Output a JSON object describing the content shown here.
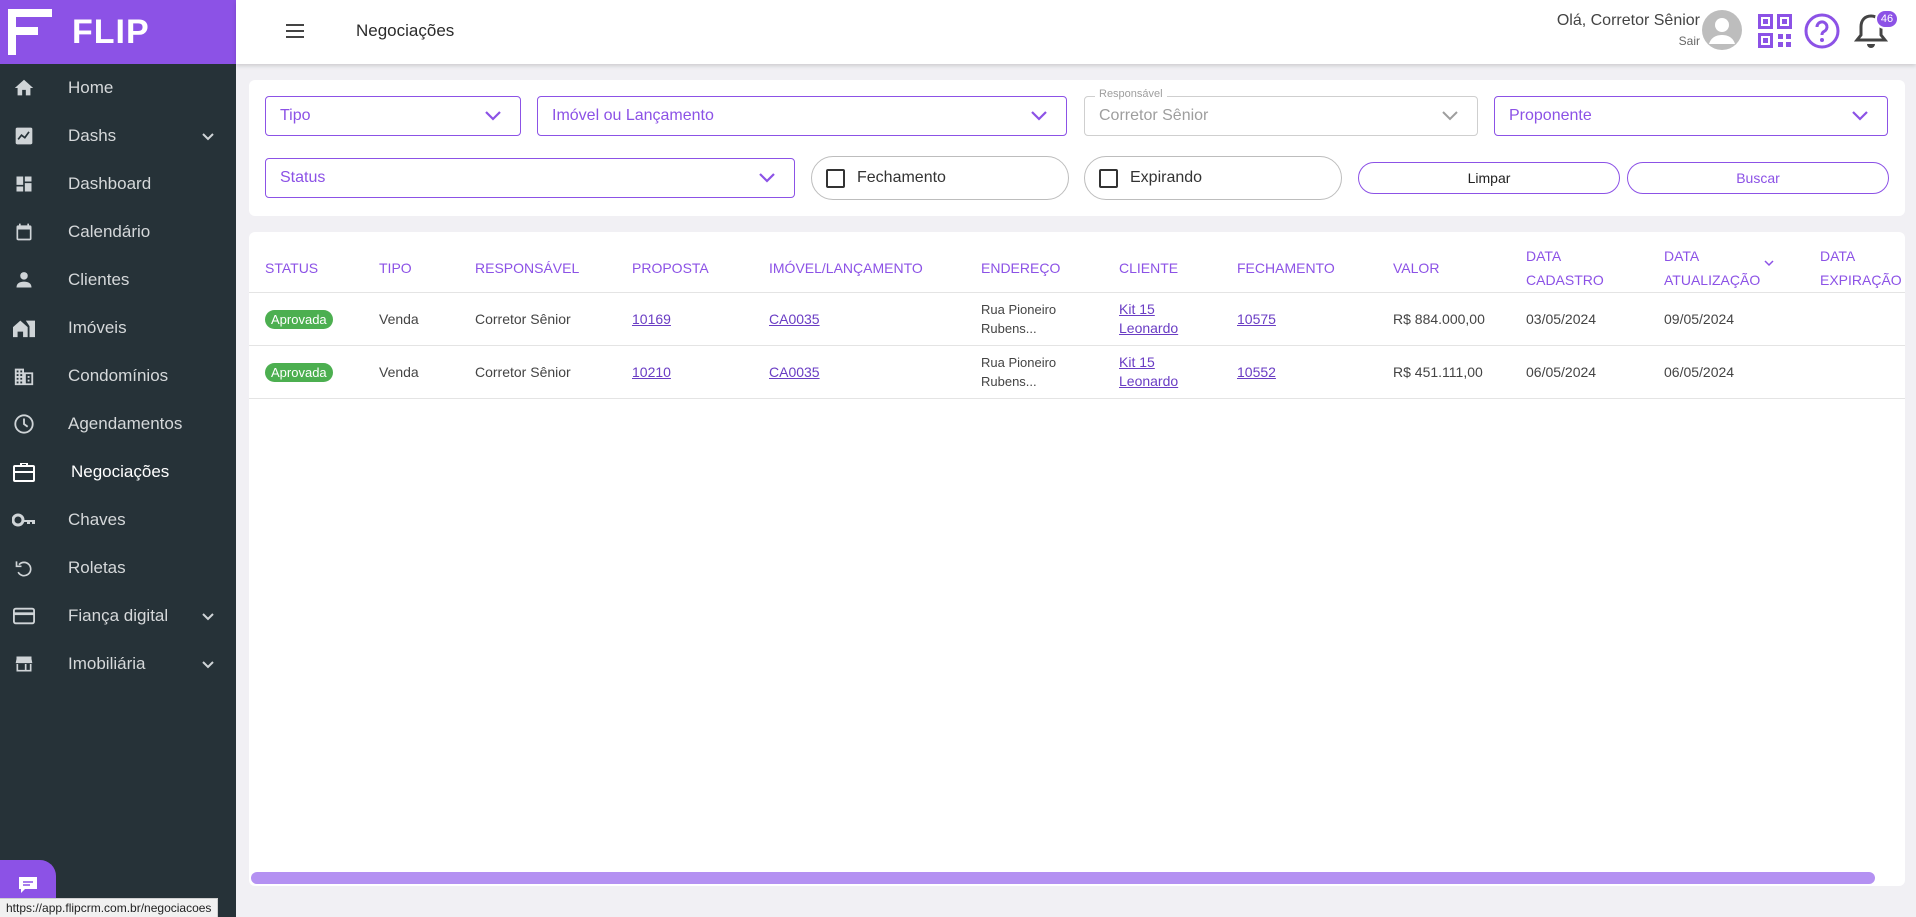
{
  "brand": {
    "name": "FLIP",
    "accent": "#8c52e6",
    "sidebar_bg": "#263238"
  },
  "sidebar": {
    "items": [
      {
        "label": "Home",
        "icon": "home-icon",
        "expandable": false,
        "active": false
      },
      {
        "label": "Dashs",
        "icon": "chart-icon",
        "expandable": true,
        "active": false
      },
      {
        "label": "Dashboard",
        "icon": "dashboard-icon",
        "expandable": false,
        "active": false
      },
      {
        "label": "Calendário",
        "icon": "calendar-icon",
        "expandable": false,
        "active": false
      },
      {
        "label": "Clientes",
        "icon": "person-icon",
        "expandable": false,
        "active": false
      },
      {
        "label": "Imóveis",
        "icon": "house-icon",
        "expandable": false,
        "active": false
      },
      {
        "label": "Condomínios",
        "icon": "building-icon",
        "expandable": false,
        "active": false
      },
      {
        "label": "Agendamentos",
        "icon": "clock-icon",
        "expandable": false,
        "active": false
      },
      {
        "label": "Negociações",
        "icon": "briefcase-icon",
        "expandable": false,
        "active": true
      },
      {
        "label": "Chaves",
        "icon": "key-icon",
        "expandable": false,
        "active": false
      },
      {
        "label": "Roletas",
        "icon": "refresh-icon",
        "expandable": false,
        "active": false
      },
      {
        "label": "Fiança digital",
        "icon": "credit-card-icon",
        "expandable": true,
        "active": false
      },
      {
        "label": "Imobiliária",
        "icon": "store-icon",
        "expandable": true,
        "active": false
      }
    ]
  },
  "status_bar_url": "https://app.flipcrm.com.br/negociacoes",
  "header": {
    "title": "Negociações",
    "greeting": "Olá, Corretor Sênior",
    "logout": "Sair",
    "notifications": "46"
  },
  "filters": {
    "tipo": "Tipo",
    "imovel": "Imóvel ou Lançamento",
    "responsavel_label": "Responsável",
    "responsavel_value": "Corretor Sênior",
    "proponente": "Proponente",
    "status": "Status",
    "fechamento": "Fechamento",
    "expirando": "Expirando",
    "limpar": "Limpar",
    "buscar": "Buscar"
  },
  "table": {
    "columns": {
      "status": "STATUS",
      "tipo": "TIPO",
      "responsavel": "RESPONSÁVEL",
      "proposta": "PROPOSTA",
      "imovel": "IMÓVEL/LANÇAMENTO",
      "endereco": "ENDEREÇO",
      "cliente": "CLIENTE",
      "fechamento": "FECHAMENTO",
      "valor": "VALOR",
      "data_cadastro_1": "DATA",
      "data_cadastro_2": "CADASTRO",
      "data_atualizacao_1": "DATA",
      "data_atualizacao_2": "ATUALIZAÇÃO",
      "data_expiracao_1": "DATA",
      "data_expiracao_2": "EXPIRAÇÃO"
    },
    "rows": [
      {
        "status": "Aprovada",
        "tipo": "Venda",
        "responsavel": "Corretor Sênior",
        "proposta": "10169",
        "imovel": "CA0035",
        "endereco_1": "Rua Pioneiro",
        "endereco_2": "Rubens...",
        "cliente_1": "Kit 15",
        "cliente_2": "Leonardo",
        "fechamento": "10575",
        "valor": "R$ 884.000,00",
        "data_cadastro": "03/05/2024",
        "data_atualizacao": "09/05/2024",
        "data_expiracao": ""
      },
      {
        "status": "Aprovada",
        "tipo": "Venda",
        "responsavel": "Corretor Sênior",
        "proposta": "10210",
        "imovel": "CA0035",
        "endereco_1": "Rua Pioneiro",
        "endereco_2": "Rubens...",
        "cliente_1": "Kit 15",
        "cliente_2": "Leonardo",
        "fechamento": "10552",
        "valor": "R$ 451.111,00",
        "data_cadastro": "06/05/2024",
        "data_atualizacao": "06/05/2024",
        "data_expiracao": ""
      }
    ]
  }
}
